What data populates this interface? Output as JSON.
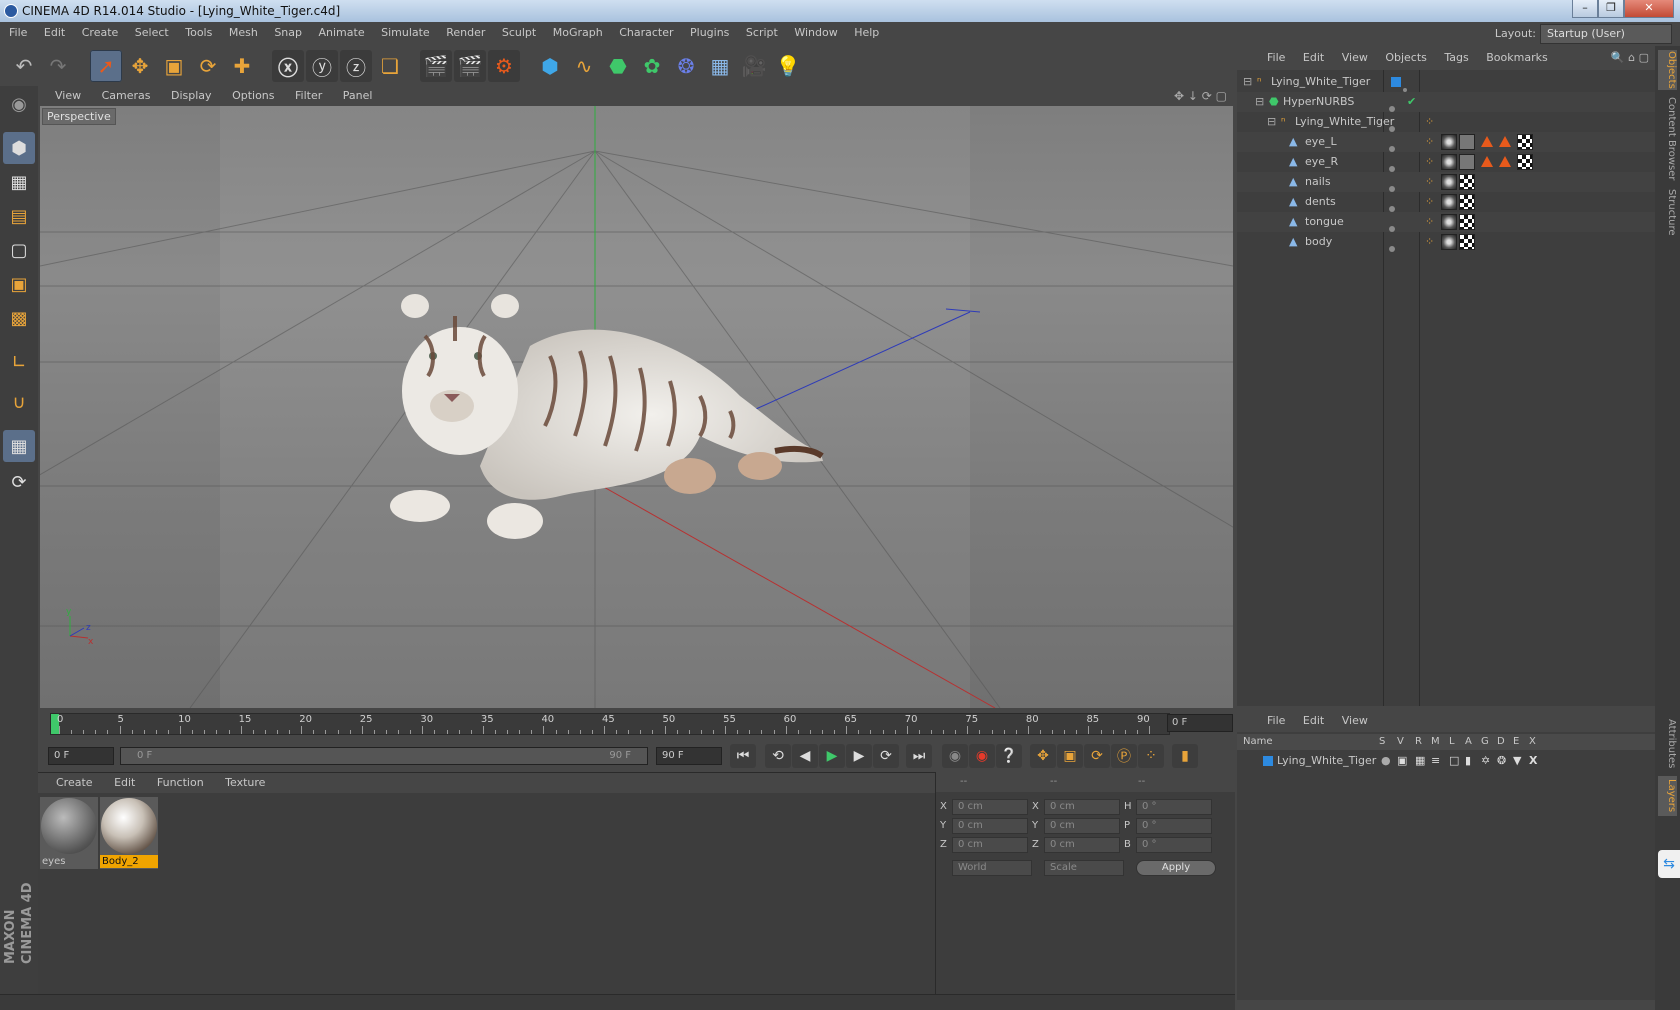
{
  "window": {
    "title": "CINEMA 4D R14.014 Studio - [Lying_White_Tiger.c4d]",
    "buttons": [
      "minimize",
      "maximize",
      "close"
    ]
  },
  "menubar": {
    "items": [
      "File",
      "Edit",
      "Create",
      "Select",
      "Tools",
      "Mesh",
      "Snap",
      "Animate",
      "Simulate",
      "Render",
      "Sculpt",
      "MoGraph",
      "Character",
      "Plugins",
      "Script",
      "Window",
      "Help"
    ],
    "layout_label": "Layout:",
    "layout_value": "Startup (User)"
  },
  "toolbar": {
    "icons": [
      "undo-icon",
      "redo-icon",
      "live-selection-icon",
      "move-icon",
      "scale-icon",
      "rotate-icon",
      "add-icon",
      "x-axis-icon",
      "y-axis-icon",
      "z-axis-icon",
      "world-coordinate-icon",
      "render-view-icon",
      "render-picture-viewer-icon",
      "render-settings-icon",
      "cube-icon",
      "spline-icon",
      "nurbs-icon",
      "array-icon",
      "deformer-icon",
      "floor-icon",
      "camera-icon",
      "light-icon"
    ]
  },
  "viewport": {
    "menu": [
      "View",
      "Cameras",
      "Display",
      "Options",
      "Filter",
      "Panel"
    ],
    "label": "Perspective"
  },
  "timeline": {
    "ticks": [
      "0",
      "5",
      "10",
      "15",
      "20",
      "25",
      "30",
      "35",
      "40",
      "45",
      "50",
      "55",
      "60",
      "65",
      "70",
      "75",
      "80",
      "85",
      "90"
    ],
    "current_frame": "0 F"
  },
  "transport": {
    "start_field": "0 F",
    "range_start": "0 F",
    "range_end": "90 F",
    "end_field": "90 F"
  },
  "materials": {
    "menu": [
      "Create",
      "Edit",
      "Function",
      "Texture"
    ],
    "items": [
      {
        "name": "eyes",
        "selected": false
      },
      {
        "name": "Body_2",
        "selected": true
      }
    ]
  },
  "coordinates": {
    "header": [
      "--",
      "--",
      "--"
    ],
    "rows": [
      {
        "a": "X",
        "a_val": "0 cm",
        "b": "X",
        "b_val": "0 cm",
        "c": "H",
        "c_val": "0 °"
      },
      {
        "a": "Y",
        "a_val": "0 cm",
        "b": "Y",
        "b_val": "0 cm",
        "c": "P",
        "c_val": "0 °"
      },
      {
        "a": "Z",
        "a_val": "0 cm",
        "b": "Z",
        "b_val": "0 cm",
        "c": "B",
        "c_val": "0 °"
      }
    ],
    "mode": "World",
    "scale": "Scale",
    "apply": "Apply"
  },
  "objects": {
    "menu": [
      "File",
      "Edit",
      "View",
      "Objects",
      "Tags",
      "Bookmarks"
    ],
    "tree": [
      {
        "name": "Lying_White_Tiger",
        "depth": 0
      },
      {
        "name": "HyperNURBS",
        "depth": 1
      },
      {
        "name": "Lying_White_Tiger",
        "depth": 2
      },
      {
        "name": "eye_L",
        "depth": 3
      },
      {
        "name": "eye_R",
        "depth": 3
      },
      {
        "name": "nails",
        "depth": 3
      },
      {
        "name": "dents",
        "depth": 3
      },
      {
        "name": "tongue",
        "depth": 3
      },
      {
        "name": "body",
        "depth": 3
      }
    ]
  },
  "layers": {
    "menu": [
      "File",
      "Edit",
      "View"
    ],
    "columns": [
      "Name",
      "S",
      "V",
      "R",
      "M",
      "L",
      "A",
      "G",
      "D",
      "E",
      "X"
    ],
    "rows": [
      {
        "name": "Lying_White_Tiger"
      }
    ]
  },
  "side_tabs": [
    "Objects",
    "Content Browser",
    "Structure",
    "Attributes",
    "Layers"
  ],
  "branding": "MAXON CINEMA 4D",
  "colors": {
    "accent": "#e8a43a",
    "selection": "#5b6f8a",
    "layer": "#2d8ae0"
  }
}
